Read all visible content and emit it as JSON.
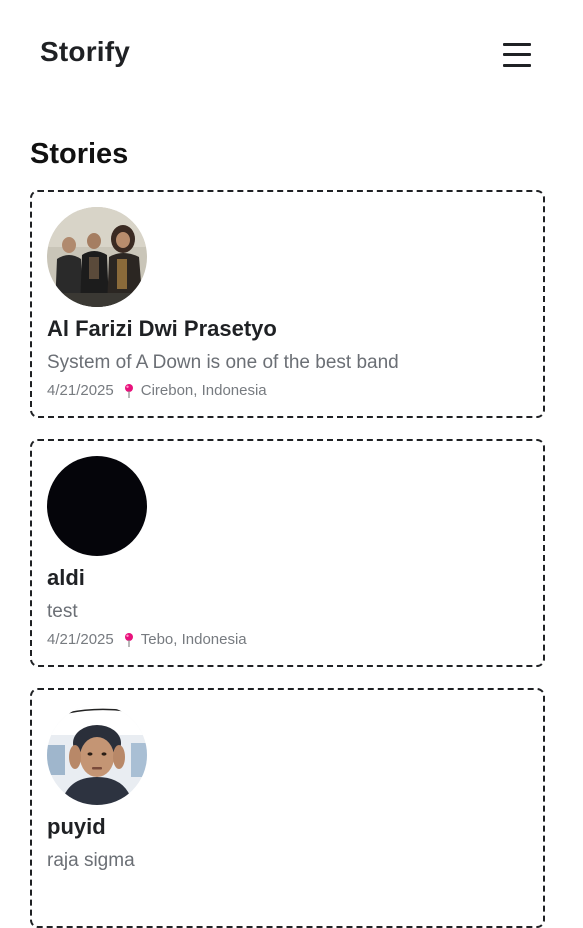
{
  "header": {
    "brand": "Storify",
    "menu_icon": "hamburger-menu-icon"
  },
  "main": {
    "section_title": "Stories",
    "stories": [
      {
        "name": "Al Farizi Dwi Prasetyo",
        "description": "System of A Down is one of the best band",
        "date": "4/21/2025",
        "location": "Cirebon, Indonesia",
        "avatar": "band-photo-avatar"
      },
      {
        "name": "aldi",
        "description": "test",
        "date": "4/21/2025",
        "location": "Tebo, Indonesia",
        "avatar": "black-circle-avatar"
      },
      {
        "name": "puyid",
        "description": "raja sigma",
        "date": "",
        "location": "",
        "avatar": "person-photo-avatar"
      }
    ]
  },
  "colors": {
    "text": "#1f2124",
    "muted": "#6b6f75",
    "pin": "#e8127c",
    "border": "#1f2124"
  }
}
